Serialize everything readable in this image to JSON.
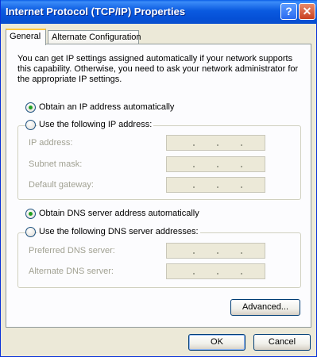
{
  "window": {
    "title": "Internet Protocol (TCP/IP) Properties",
    "help_glyph": "?",
    "close_glyph": "✕"
  },
  "tabs": [
    {
      "label": "General",
      "active": true
    },
    {
      "label": "Alternate Configuration",
      "active": false
    }
  ],
  "intro_text": "You can get IP settings assigned automatically if your network supports this capability. Otherwise, you need to ask your network administrator for the appropriate IP settings.",
  "ip": {
    "auto_label": "Obtain an IP address automatically",
    "manual_label": "Use the following IP address:",
    "selected": "auto",
    "fields": [
      {
        "label": "IP address:",
        "value": ""
      },
      {
        "label": "Subnet mask:",
        "value": ""
      },
      {
        "label": "Default gateway:",
        "value": ""
      }
    ]
  },
  "dns": {
    "auto_label": "Obtain DNS server address automatically",
    "manual_label": "Use the following DNS server addresses:",
    "selected": "auto",
    "fields": [
      {
        "label": "Preferred DNS server:",
        "value": ""
      },
      {
        "label": "Alternate DNS server:",
        "value": ""
      }
    ]
  },
  "buttons": {
    "advanced": "Advanced...",
    "ok": "OK",
    "cancel": "Cancel"
  },
  "colors": {
    "titlebar": "#0A5AE0",
    "dialog_bg": "#ECE9D8",
    "panel_bg": "#FCFCFE",
    "radio_dot": "#21A121",
    "disabled_text": "#A1A192"
  }
}
